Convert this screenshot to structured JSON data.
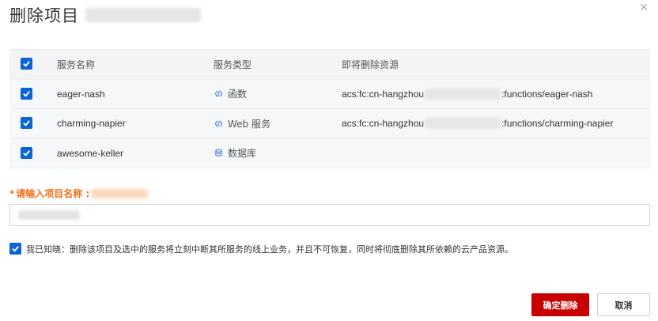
{
  "dialog": {
    "title": "删除项目",
    "close_icon": "close-icon"
  },
  "table": {
    "headers": {
      "name": "服务名称",
      "type": "服务类型",
      "resource": "即将删除资源"
    },
    "rows": [
      {
        "name": "eager-nash",
        "type_icon": "function-icon",
        "type": "函数",
        "resource_prefix": "acs:fc:cn-hangzhou",
        "resource_suffix": ":functions/eager-nash"
      },
      {
        "name": "charming-napier",
        "type_icon": "function-icon",
        "type": "Web 服务",
        "resource_prefix": "acs:fc:cn-hangzhou",
        "resource_suffix": ":functions/charming-napier"
      },
      {
        "name": "awesome-keller",
        "type_icon": "database-icon",
        "type": "数据库",
        "resource_prefix": "",
        "resource_suffix": ""
      }
    ]
  },
  "form": {
    "required_mark": "*",
    "label": "请输入项目名称 :"
  },
  "acknowledge": {
    "text": "我已知晓：删除该项目及选中的服务将立刻中断其所服务的线上业务，并且不可恢复，同时将彻底删除其所依赖的云产品资源。"
  },
  "buttons": {
    "confirm": "确定删除",
    "cancel": "取消"
  },
  "colors": {
    "primary_danger": "#c80000",
    "checkbox": "#0a64d1",
    "label_accent": "#f2711c"
  }
}
